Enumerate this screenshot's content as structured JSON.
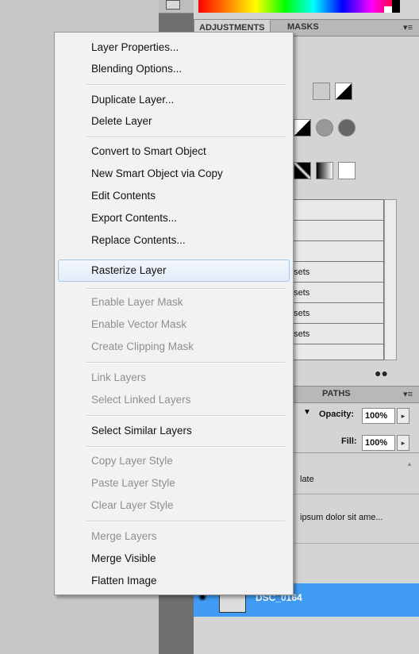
{
  "adjustments_panel": {
    "tab_adjustments": "ADJUSTMENTS",
    "tab_masks": "MASKS",
    "presets": [
      "ts",
      "Presets",
      "Presets",
      "Presets",
      "Presets"
    ],
    "preset_prefix": [
      "",
      "",
      "",
      "n ",
      "",
      "",
      "r "
    ]
  },
  "layers_panel": {
    "tab_paths": "PATHS",
    "tab_ls": "LS",
    "opacity_label": "Opacity:",
    "opacity_value": "100%",
    "fill_label": "Fill:",
    "fill_value": "100%",
    "layer_1": "late",
    "layer_2": "ipsum dolor sit ame...",
    "layer_selected": "DSC_0164"
  },
  "context_menu": {
    "items": [
      {
        "label": "Layer Properties...",
        "enabled": true
      },
      {
        "label": "Blending Options...",
        "enabled": true
      },
      {
        "label": "Duplicate Layer...",
        "enabled": true
      },
      {
        "label": "Delete Layer",
        "enabled": true
      },
      {
        "label": "Convert to Smart Object",
        "enabled": true
      },
      {
        "label": "New Smart Object via Copy",
        "enabled": true
      },
      {
        "label": "Edit Contents",
        "enabled": true
      },
      {
        "label": "Export Contents...",
        "enabled": true
      },
      {
        "label": "Replace Contents...",
        "enabled": true
      },
      {
        "label": "Rasterize Layer",
        "enabled": true,
        "highlighted": true
      },
      {
        "label": "Enable Layer Mask",
        "enabled": false
      },
      {
        "label": "Enable Vector Mask",
        "enabled": false
      },
      {
        "label": "Create Clipping Mask",
        "enabled": false
      },
      {
        "label": "Link Layers",
        "enabled": false
      },
      {
        "label": "Select Linked Layers",
        "enabled": false
      },
      {
        "label": "Select Similar Layers",
        "enabled": true
      },
      {
        "label": "Copy Layer Style",
        "enabled": false
      },
      {
        "label": "Paste Layer Style",
        "enabled": false
      },
      {
        "label": "Clear Layer Style",
        "enabled": false
      },
      {
        "label": "Merge Layers",
        "enabled": false
      },
      {
        "label": "Merge Visible",
        "enabled": true
      },
      {
        "label": "Flatten Image",
        "enabled": true
      }
    ]
  },
  "colors": {
    "menu_bg": "#f2f2f2",
    "selected_layer": "#3f9cf2",
    "disabled_text": "#8f8f8f"
  }
}
